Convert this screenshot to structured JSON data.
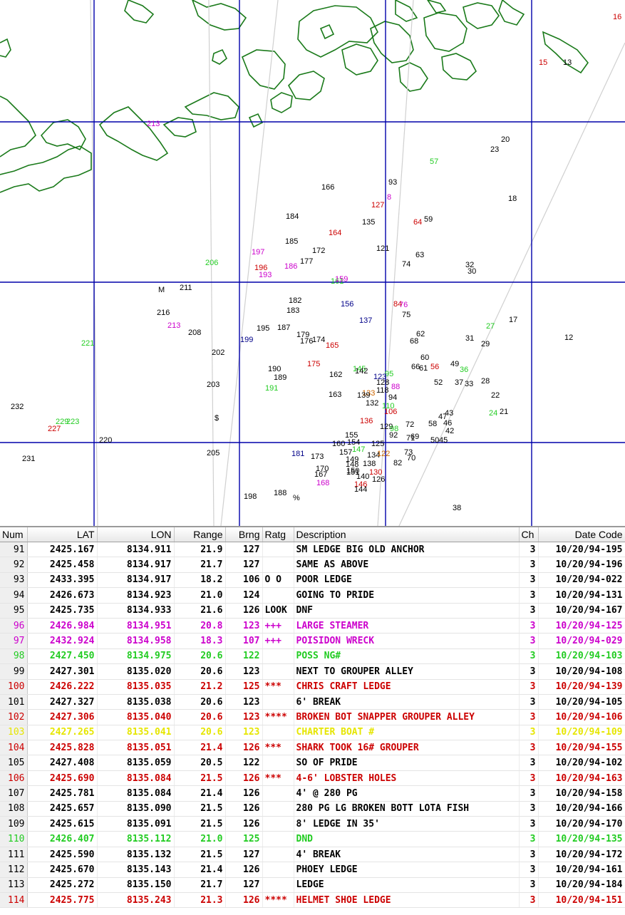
{
  "colors": {
    "grid": "#0000aa",
    "coast": "#1a7a1a",
    "black": "#000000",
    "red": "#cc0000",
    "magenta": "#cc00cc",
    "green": "#22cc22",
    "navy": "#000088",
    "yellow": "#e6e600",
    "orange": "#cc6600"
  },
  "map_labels": [
    {
      "t": "213",
      "c": "magenta"
    },
    {
      "t": "15",
      "c": "red"
    },
    {
      "t": "13",
      "c": "black"
    },
    {
      "t": "16",
      "c": "red"
    },
    {
      "t": "20",
      "c": "black"
    },
    {
      "t": "23",
      "c": "black"
    },
    {
      "t": "57",
      "c": "green"
    },
    {
      "t": "93",
      "c": "black"
    },
    {
      "t": "166",
      "c": "black"
    },
    {
      "t": "18",
      "c": "black"
    },
    {
      "t": "8",
      "c": "magenta"
    },
    {
      "t": "127",
      "c": "red"
    },
    {
      "t": "184",
      "c": "black"
    },
    {
      "t": "135",
      "c": "black"
    },
    {
      "t": "64",
      "c": "red"
    },
    {
      "t": "59",
      "c": "black"
    },
    {
      "t": "164",
      "c": "red"
    },
    {
      "t": "185",
      "c": "black"
    },
    {
      "t": "172",
      "c": "black"
    },
    {
      "t": "121",
      "c": "black"
    },
    {
      "t": "63",
      "c": "black"
    },
    {
      "t": "197",
      "c": "magenta"
    },
    {
      "t": "206",
      "c": "green"
    },
    {
      "t": "177",
      "c": "black"
    },
    {
      "t": "74",
      "c": "black"
    },
    {
      "t": "32",
      "c": "black"
    },
    {
      "t": "30",
      "c": "black"
    },
    {
      "t": "196",
      "c": "red"
    },
    {
      "t": "186",
      "c": "magenta"
    },
    {
      "t": "193",
      "c": "magenta"
    },
    {
      "t": "161",
      "c": "green"
    },
    {
      "t": "159",
      "c": "magenta"
    },
    {
      "t": "M",
      "c": "black"
    },
    {
      "t": "211",
      "c": "black"
    },
    {
      "t": "182",
      "c": "black"
    },
    {
      "t": "156",
      "c": "navy"
    },
    {
      "t": "84",
      "c": "red"
    },
    {
      "t": "76",
      "c": "magenta"
    },
    {
      "t": "183",
      "c": "black"
    },
    {
      "t": "75",
      "c": "black"
    },
    {
      "t": "216",
      "c": "black"
    },
    {
      "t": "137",
      "c": "navy"
    },
    {
      "t": "17",
      "c": "black"
    },
    {
      "t": "27",
      "c": "green"
    },
    {
      "t": "213",
      "c": "magenta"
    },
    {
      "t": "195",
      "c": "black"
    },
    {
      "t": "187",
      "c": "black"
    },
    {
      "t": "208",
      "c": "black"
    },
    {
      "t": "179",
      "c": "black"
    },
    {
      "t": "62",
      "c": "black"
    },
    {
      "t": "221",
      "c": "green"
    },
    {
      "t": "199",
      "c": "navy"
    },
    {
      "t": "176",
      "c": "black"
    },
    {
      "t": "174",
      "c": "black"
    },
    {
      "t": "68",
      "c": "black"
    },
    {
      "t": "31",
      "c": "black"
    },
    {
      "t": "12",
      "c": "black"
    },
    {
      "t": "165",
      "c": "red"
    },
    {
      "t": "29",
      "c": "black"
    },
    {
      "t": "202",
      "c": "black"
    },
    {
      "t": "60",
      "c": "black"
    },
    {
      "t": "175",
      "c": "red"
    },
    {
      "t": "66",
      "c": "black"
    },
    {
      "t": "61",
      "c": "black"
    },
    {
      "t": "56",
      "c": "red"
    },
    {
      "t": "49",
      "c": "black"
    },
    {
      "t": "190",
      "c": "black"
    },
    {
      "t": "145",
      "c": "green"
    },
    {
      "t": "142",
      "c": "black"
    },
    {
      "t": "36",
      "c": "green"
    },
    {
      "t": "162",
      "c": "black"
    },
    {
      "t": "189",
      "c": "black"
    },
    {
      "t": "95",
      "c": "green"
    },
    {
      "t": "123",
      "c": "navy"
    },
    {
      "t": "52",
      "c": "black"
    },
    {
      "t": "37",
      "c": "black"
    },
    {
      "t": "33",
      "c": "black"
    },
    {
      "t": "28",
      "c": "black"
    },
    {
      "t": "203",
      "c": "black"
    },
    {
      "t": "191",
      "c": "green"
    },
    {
      "t": "128",
      "c": "black"
    },
    {
      "t": "88",
      "c": "magenta"
    },
    {
      "t": "118",
      "c": "black"
    },
    {
      "t": "163",
      "c": "black"
    },
    {
      "t": "133",
      "c": "orange"
    },
    {
      "t": "139",
      "c": "black"
    },
    {
      "t": "94",
      "c": "black"
    },
    {
      "t": "22",
      "c": "black"
    },
    {
      "t": "132",
      "c": "black"
    },
    {
      "t": "110",
      "c": "green"
    },
    {
      "t": "232",
      "c": "black"
    },
    {
      "t": "106",
      "c": "red"
    },
    {
      "t": "43",
      "c": "black"
    },
    {
      "t": "24",
      "c": "green"
    },
    {
      "t": "21",
      "c": "black"
    },
    {
      "t": "$",
      "c": "black"
    },
    {
      "t": "47",
      "c": "black"
    },
    {
      "t": "229",
      "c": "green"
    },
    {
      "t": "223",
      "c": "green"
    },
    {
      "t": "136",
      "c": "red"
    },
    {
      "t": "72",
      "c": "black"
    },
    {
      "t": "58",
      "c": "black"
    },
    {
      "t": "46",
      "c": "black"
    },
    {
      "t": "227",
      "c": "red"
    },
    {
      "t": "129",
      "c": "black"
    },
    {
      "t": "98",
      "c": "green"
    },
    {
      "t": "42",
      "c": "black"
    },
    {
      "t": "155",
      "c": "black"
    },
    {
      "t": "92",
      "c": "black"
    },
    {
      "t": "69",
      "c": "black"
    },
    {
      "t": "71",
      "c": "black"
    },
    {
      "t": "50",
      "c": "black"
    },
    {
      "t": "45",
      "c": "black"
    },
    {
      "t": "220",
      "c": "black"
    },
    {
      "t": "160",
      "c": "black"
    },
    {
      "t": "154",
      "c": "black"
    },
    {
      "t": "125",
      "c": "black"
    },
    {
      "t": "205",
      "c": "black"
    },
    {
      "t": "181",
      "c": "navy"
    },
    {
      "t": "157",
      "c": "black"
    },
    {
      "t": "147",
      "c": "green"
    },
    {
      "t": "173",
      "c": "black"
    },
    {
      "t": "134",
      "c": "black"
    },
    {
      "t": "122",
      "c": "orange"
    },
    {
      "t": "73",
      "c": "black"
    },
    {
      "t": "231",
      "c": "black"
    },
    {
      "t": "149",
      "c": "black"
    },
    {
      "t": "70",
      "c": "black"
    },
    {
      "t": "148",
      "c": "black"
    },
    {
      "t": "138",
      "c": "black"
    },
    {
      "t": "82",
      "c": "black"
    },
    {
      "t": "170",
      "c": "black"
    },
    {
      "t": "150",
      "c": "black"
    },
    {
      "t": "130",
      "c": "red"
    },
    {
      "t": "167",
      "c": "black"
    },
    {
      "t": "151",
      "c": "black"
    },
    {
      "t": "140",
      "c": "black"
    },
    {
      "t": "126",
      "c": "black"
    },
    {
      "t": "168",
      "c": "magenta"
    },
    {
      "t": "146",
      "c": "red"
    },
    {
      "t": "144",
      "c": "black"
    },
    {
      "t": "198",
      "c": "black"
    },
    {
      "t": "188",
      "c": "black"
    },
    {
      "t": "%",
      "c": "black"
    },
    {
      "t": "38",
      "c": "black"
    }
  ],
  "table": {
    "headers": [
      "Num",
      "LAT",
      "LON",
      "Range",
      "Brng",
      "Ratg",
      "Description",
      "Ch",
      "Date Code"
    ],
    "rows": [
      {
        "num": "91",
        "lat": "2425.167",
        "lon": "8134.911",
        "range": "21.9",
        "brng": "127",
        "ratg": "",
        "desc": "SM LEDGE BIG OLD ANCHOR",
        "ch": "3",
        "date": "10/20/94-195",
        "c": "black"
      },
      {
        "num": "92",
        "lat": "2425.458",
        "lon": "8134.917",
        "range": "21.7",
        "brng": "127",
        "ratg": "",
        "desc": "SAME AS ABOVE",
        "ch": "3",
        "date": "10/20/94-196",
        "c": "black"
      },
      {
        "num": "93",
        "lat": "2433.395",
        "lon": "8134.917",
        "range": "18.2",
        "brng": "106",
        "ratg": "O O",
        "desc": "POOR LEDGE",
        "ch": "3",
        "date": "10/20/94-022",
        "c": "black"
      },
      {
        "num": "94",
        "lat": "2426.673",
        "lon": "8134.923",
        "range": "21.0",
        "brng": "124",
        "ratg": "",
        "desc": "GOING TO PRIDE",
        "ch": "3",
        "date": "10/20/94-131",
        "c": "black"
      },
      {
        "num": "95",
        "lat": "2425.735",
        "lon": "8134.933",
        "range": "21.6",
        "brng": "126",
        "ratg": "LOOK",
        "desc": "DNF",
        "ch": "3",
        "date": "10/20/94-167",
        "c": "black"
      },
      {
        "num": "96",
        "lat": "2426.984",
        "lon": "8134.951",
        "range": "20.8",
        "brng": "123",
        "ratg": "+++",
        "desc": "LARGE STEAMER",
        "ch": "3",
        "date": "10/20/94-125",
        "c": "magenta"
      },
      {
        "num": "97",
        "lat": "2432.924",
        "lon": "8134.958",
        "range": "18.3",
        "brng": "107",
        "ratg": "+++",
        "desc": "POISIDON WRECK",
        "ch": "3",
        "date": "10/20/94-029",
        "c": "magenta"
      },
      {
        "num": "98",
        "lat": "2427.450",
        "lon": "8134.975",
        "range": "20.6",
        "brng": "122",
        "ratg": "",
        "desc": "POSS NG#",
        "ch": "3",
        "date": "10/20/94-103",
        "c": "green"
      },
      {
        "num": "99",
        "lat": "2427.301",
        "lon": "8135.020",
        "range": "20.6",
        "brng": "123",
        "ratg": "",
        "desc": "NEXT TO GROUPER ALLEY",
        "ch": "3",
        "date": "10/20/94-108",
        "c": "black"
      },
      {
        "num": "100",
        "lat": "2426.222",
        "lon": "8135.035",
        "range": "21.2",
        "brng": "125",
        "ratg": "***",
        "desc": "CHRIS CRAFT LEDGE",
        "ch": "3",
        "date": "10/20/94-139",
        "c": "red"
      },
      {
        "num": "101",
        "lat": "2427.327",
        "lon": "8135.038",
        "range": "20.6",
        "brng": "123",
        "ratg": "",
        "desc": "6' BREAK",
        "ch": "3",
        "date": "10/20/94-105",
        "c": "black"
      },
      {
        "num": "102",
        "lat": "2427.306",
        "lon": "8135.040",
        "range": "20.6",
        "brng": "123",
        "ratg": "****",
        "desc": "BROKEN BOT SNAPPER GROUPER ALLEY",
        "ch": "3",
        "date": "10/20/94-106",
        "c": "red"
      },
      {
        "num": "103",
        "lat": "2427.265",
        "lon": "8135.041",
        "range": "20.6",
        "brng": "123",
        "ratg": "",
        "desc": "CHARTER BOAT #",
        "ch": "3",
        "date": "10/20/94-109",
        "c": "yellow"
      },
      {
        "num": "104",
        "lat": "2425.828",
        "lon": "8135.051",
        "range": "21.4",
        "brng": "126",
        "ratg": "***",
        "desc": "SHARK TOOK 16# GROUPER",
        "ch": "3",
        "date": "10/20/94-155",
        "c": "red"
      },
      {
        "num": "105",
        "lat": "2427.408",
        "lon": "8135.059",
        "range": "20.5",
        "brng": "122",
        "ratg": "",
        "desc": "SO OF PRIDE",
        "ch": "3",
        "date": "10/20/94-102",
        "c": "black"
      },
      {
        "num": "106",
        "lat": "2425.690",
        "lon": "8135.084",
        "range": "21.5",
        "brng": "126",
        "ratg": "***",
        "desc": "4-6' LOBSTER HOLES",
        "ch": "3",
        "date": "10/20/94-163",
        "c": "red"
      },
      {
        "num": "107",
        "lat": "2425.781",
        "lon": "8135.084",
        "range": "21.4",
        "brng": "126",
        "ratg": "",
        "desc": "4' @ 280 PG",
        "ch": "3",
        "date": "10/20/94-158",
        "c": "black"
      },
      {
        "num": "108",
        "lat": "2425.657",
        "lon": "8135.090",
        "range": "21.5",
        "brng": "126",
        "ratg": "",
        "desc": "280 PG LG BROKEN BOTT LOTA FISH",
        "ch": "3",
        "date": "10/20/94-166",
        "c": "black"
      },
      {
        "num": "109",
        "lat": "2425.615",
        "lon": "8135.091",
        "range": "21.5",
        "brng": "126",
        "ratg": "",
        "desc": "8' LEDGE IN 35'",
        "ch": "3",
        "date": "10/20/94-170",
        "c": "black"
      },
      {
        "num": "110",
        "lat": "2426.407",
        "lon": "8135.112",
        "range": "21.0",
        "brng": "125",
        "ratg": "",
        "desc": "DND",
        "ch": "3",
        "date": "10/20/94-135",
        "c": "green"
      },
      {
        "num": "111",
        "lat": "2425.590",
        "lon": "8135.132",
        "range": "21.5",
        "brng": "127",
        "ratg": "",
        "desc": "4' BREAK",
        "ch": "3",
        "date": "10/20/94-172",
        "c": "black"
      },
      {
        "num": "112",
        "lat": "2425.670",
        "lon": "8135.143",
        "range": "21.4",
        "brng": "126",
        "ratg": "",
        "desc": "PHOEY LEDGE",
        "ch": "3",
        "date": "10/20/94-161",
        "c": "black"
      },
      {
        "num": "113",
        "lat": "2425.272",
        "lon": "8135.150",
        "range": "21.7",
        "brng": "127",
        "ratg": "",
        "desc": "LEDGE",
        "ch": "3",
        "date": "10/20/94-184",
        "c": "black"
      },
      {
        "num": "114",
        "lat": "2425.775",
        "lon": "8135.243",
        "range": "21.3",
        "brng": "126",
        "ratg": "****",
        "desc": "HELMET SHOE LEDGE",
        "ch": "3",
        "date": "10/20/94-151",
        "c": "red"
      }
    ]
  }
}
